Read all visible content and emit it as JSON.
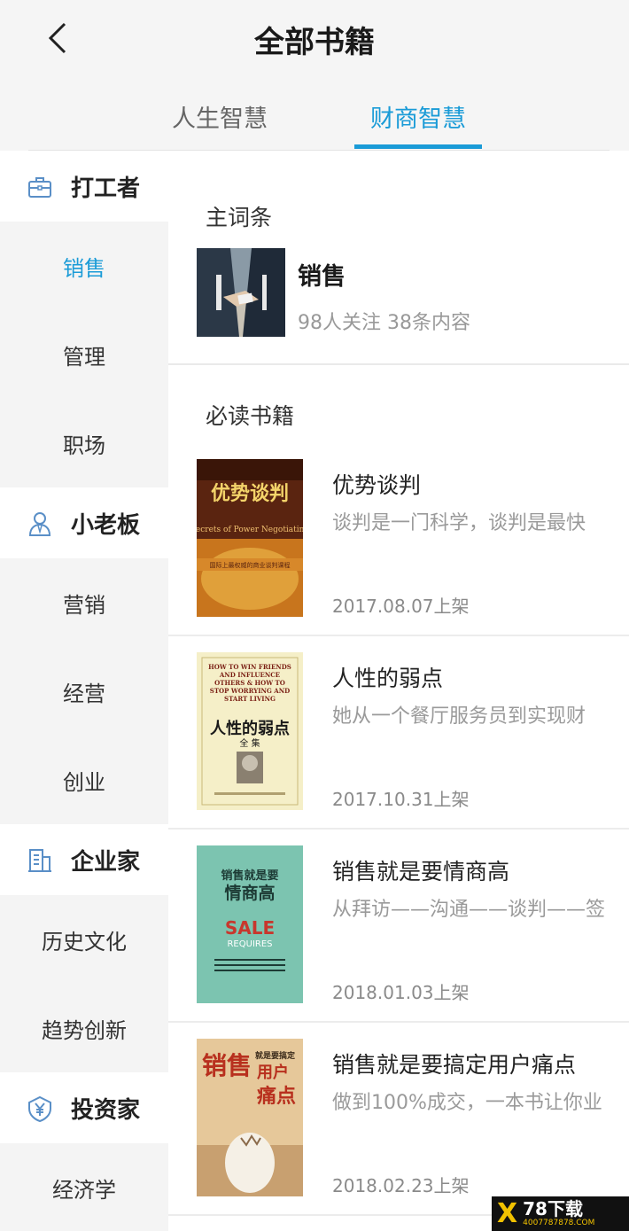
{
  "header": {
    "title": "全部书籍",
    "tabs": [
      {
        "label": "人生智慧",
        "active": false
      },
      {
        "label": "财商智慧",
        "active": true
      }
    ]
  },
  "sidebar": {
    "sections": [
      {
        "label": "打工者",
        "icon": "briefcase-icon",
        "items": [
          "销售",
          "管理",
          "职场"
        ],
        "active_item": "销售"
      },
      {
        "label": "小老板",
        "icon": "person-icon",
        "items": [
          "营销",
          "经营",
          "创业"
        ]
      },
      {
        "label": "企业家",
        "icon": "building-icon",
        "items": [
          "历史文化",
          "趋势创新"
        ]
      },
      {
        "label": "投资家",
        "icon": "yen-shield-icon",
        "items": [
          "经济学"
        ]
      }
    ]
  },
  "main": {
    "term_section_title": "主词条",
    "term": {
      "name": "销售",
      "meta": "98人关注  38条内容"
    },
    "books_section_title": "必读书籍",
    "books": [
      {
        "title": "优势谈判",
        "desc": "谈判是一门科学，谈判是最快",
        "date": "2017.08.07上架"
      },
      {
        "title": "人性的弱点",
        "desc": "她从一个餐厅服务员到实现财",
        "date": "2017.10.31上架"
      },
      {
        "title": "销售就是要情商高",
        "desc": "从拜访——沟通——谈判——签",
        "date": "2018.01.03上架"
      },
      {
        "title": "销售就是要搞定用户痛点",
        "desc": "做到100%成交，一本书让你业",
        "date": "2018.02.23上架"
      }
    ]
  },
  "covers": {
    "book1": {
      "main": "优势谈判",
      "sub": "Secrets of Power Negotiating",
      "tag": "国际上最权威的商业谈判课程"
    },
    "book2": {
      "en": "HOW TO WIN FRIENDS AND INFLUENCE OTHERS & HOW TO STOP WORRYING AND START LIVING",
      "main": "人性的弱点",
      "sub": "全 集"
    },
    "book3": {
      "top": "销售就是要",
      "main": "情商高",
      "en": "SALE",
      "en2": "REQUIRES"
    },
    "book4": {
      "main": "销售",
      "side": "就是要搞定",
      "main2": "用户",
      "main3": "痛点"
    }
  },
  "watermark": {
    "brand": "78下载",
    "url": "4007787878.COM"
  },
  "colors": {
    "accent": "#1a9bd7",
    "sidebar_bg": "#f4f4f4",
    "header_bg": "#f5f5f5"
  }
}
